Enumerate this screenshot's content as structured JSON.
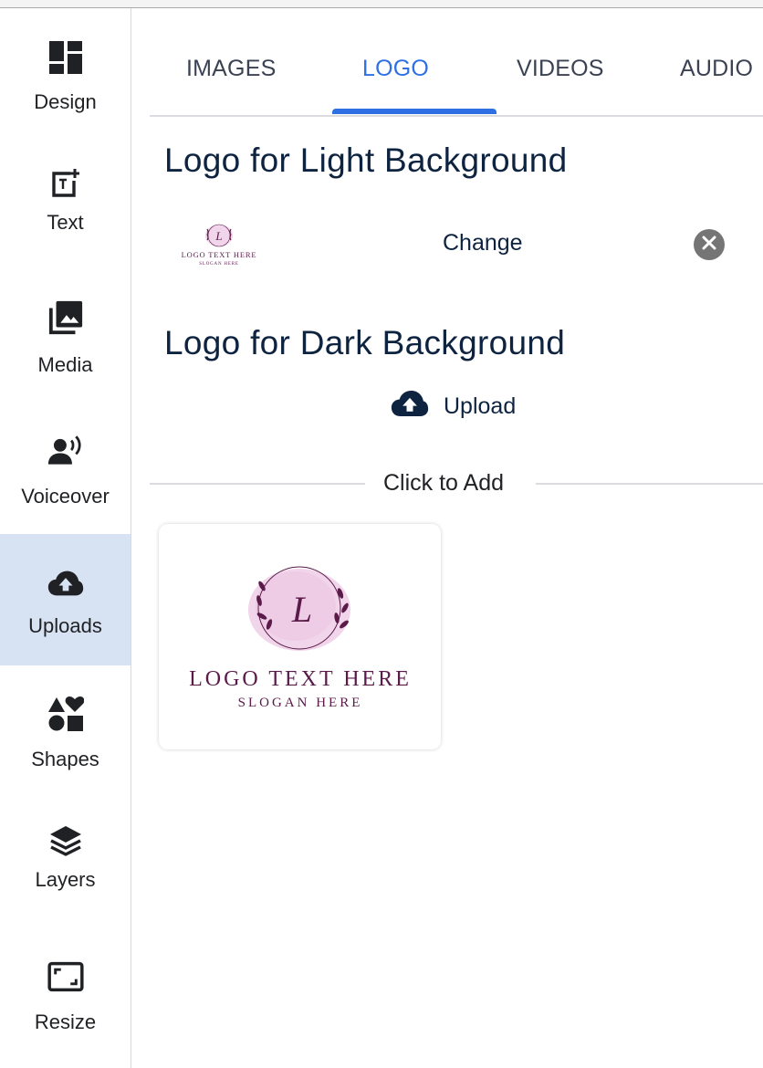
{
  "sidebar": {
    "items": [
      {
        "label": "Design",
        "icon": "design-grid-icon",
        "active": false
      },
      {
        "label": "Text",
        "icon": "text-add-icon",
        "active": false
      },
      {
        "label": "Media",
        "icon": "media-library-icon",
        "active": false
      },
      {
        "label": "Voiceover",
        "icon": "voiceover-icon",
        "active": false
      },
      {
        "label": "Uploads",
        "icon": "cloud-upload-icon",
        "active": true
      },
      {
        "label": "Shapes",
        "icon": "shapes-icon",
        "active": false
      },
      {
        "label": "Layers",
        "icon": "layers-icon",
        "active": false
      },
      {
        "label": "Resize",
        "icon": "resize-icon",
        "active": false
      }
    ]
  },
  "tabs": [
    {
      "label": "IMAGES",
      "active": false
    },
    {
      "label": "LOGO",
      "active": true
    },
    {
      "label": "VIDEOS",
      "active": false
    },
    {
      "label": "AUDIO",
      "active": false
    }
  ],
  "light_logo": {
    "title": "Logo for Light Background",
    "change_label": "Change",
    "remove_icon": "close-circle-icon"
  },
  "dark_logo": {
    "title": "Logo for Dark Background",
    "upload_label": "Upload",
    "upload_icon": "cloud-upload-icon"
  },
  "click_to_add": "Click to Add",
  "logo_asset": {
    "monogram": "L",
    "logo_text": "LOGO TEXT HERE",
    "slogan": "SLOGAN HERE"
  },
  "colors": {
    "accent": "#2f6fe4",
    "active_sidebar_bg": "#d7e3f3",
    "heading": "#0d2340",
    "logo_purple": "#5a1a4a",
    "logo_pink": "#f1d5ea"
  }
}
